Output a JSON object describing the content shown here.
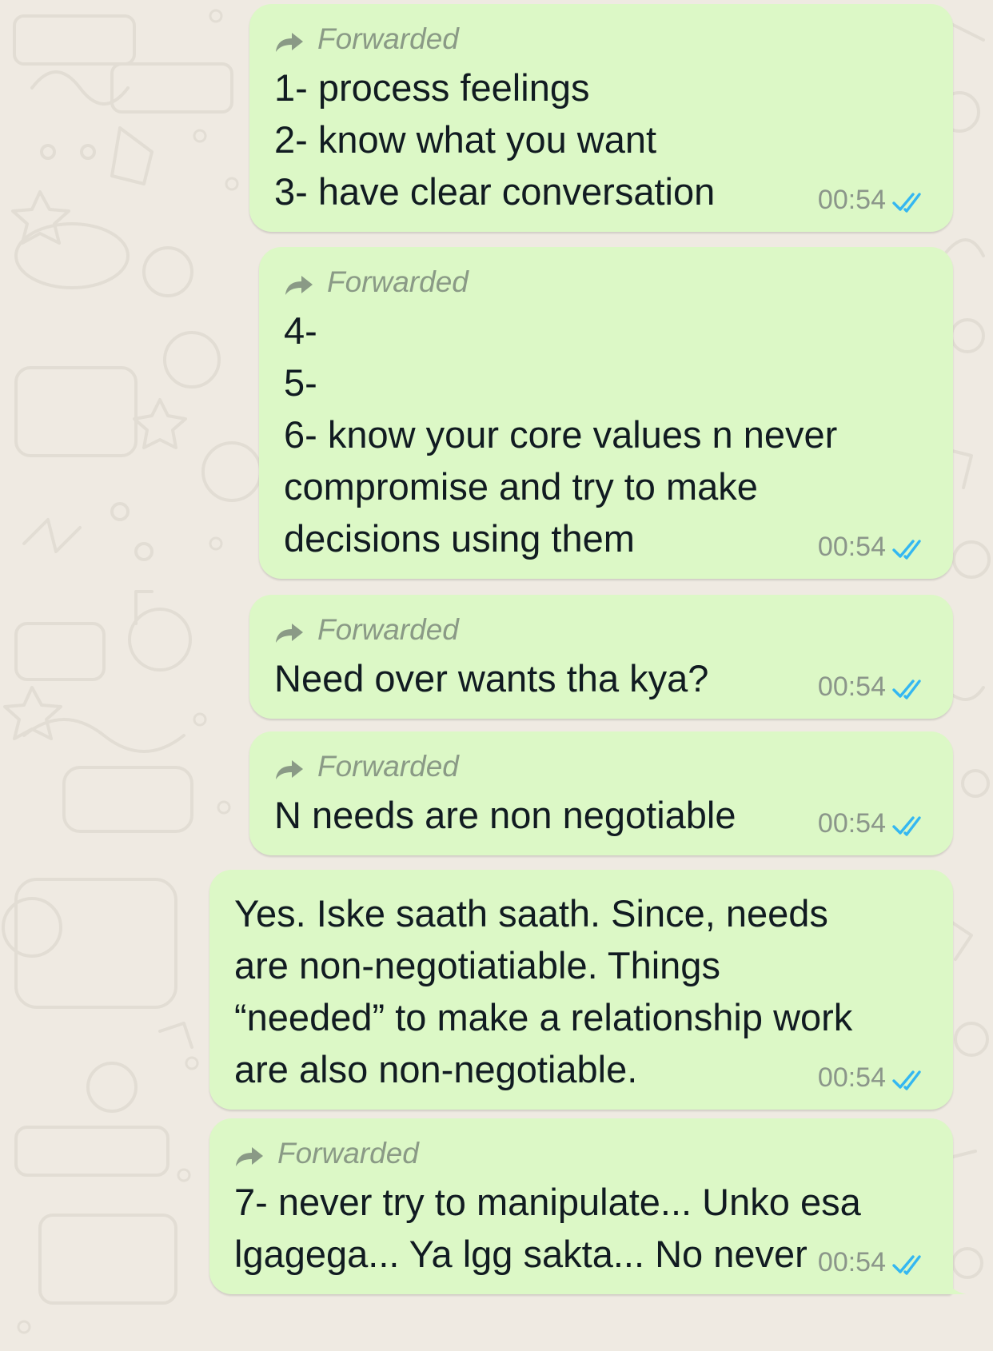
{
  "theme": {
    "background": "#efeae2",
    "bubble_outgoing": "#dcf8c6",
    "tick_read_color": "#34b7f1",
    "forwarded_color": "#8a9a86"
  },
  "messages": [
    {
      "forwarded": true,
      "forwarded_label": "Forwarded",
      "lines": [
        "1- process feelings",
        "2- know what you want",
        "3- have clear conversation"
      ],
      "time": "00:54",
      "status_icon": "double-check-read-icon"
    },
    {
      "forwarded": true,
      "forwarded_label": "Forwarded",
      "lines": [
        "4-",
        "5-",
        "6- know your core values n never",
        "compromise and try to make",
        "decisions using them"
      ],
      "time": "00:54",
      "status_icon": "double-check-read-icon"
    },
    {
      "forwarded": true,
      "forwarded_label": "Forwarded",
      "lines": [
        "Need over wants tha kya?"
      ],
      "time": "00:54",
      "status_icon": "double-check-read-icon"
    },
    {
      "forwarded": true,
      "forwarded_label": "Forwarded",
      "lines": [
        "N needs are non negotiable"
      ],
      "time": "00:54",
      "status_icon": "double-check-read-icon"
    },
    {
      "forwarded": false,
      "lines": [
        "Yes. Iske saath saath. Since, needs",
        "are non-negotiatiable. Things",
        "“needed” to make a relationship work",
        "are also non-negotiable."
      ],
      "time": "00:54",
      "status_icon": "double-check-read-icon"
    },
    {
      "forwarded": true,
      "forwarded_label": "Forwarded",
      "lines": [
        "7- never try to manipulate... Unko esa",
        "lgagega... Ya lgg sakta... No never"
      ],
      "time": "00:54",
      "status_icon": "double-check-read-icon"
    }
  ]
}
